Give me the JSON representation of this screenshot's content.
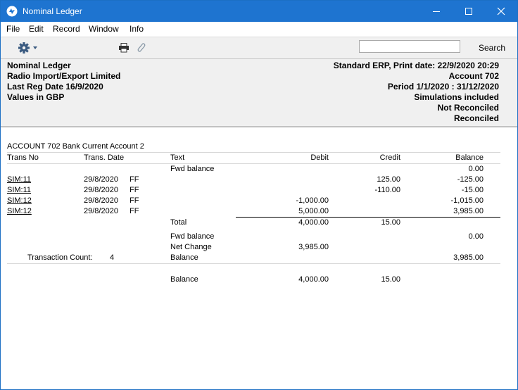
{
  "window": {
    "title": "Nominal Ledger"
  },
  "menu": [
    "File",
    "Edit",
    "Record",
    "Window",
    "Info"
  ],
  "toolbar": {
    "search_label": "Search",
    "search_value": ""
  },
  "header": {
    "left": [
      "Nominal Ledger",
      "Radio Import/Export Limited",
      "Last Reg Date  16/9/2020",
      "Values in GBP"
    ],
    "right": [
      "Standard ERP, Print date: 22/9/2020 20:29",
      "Account  702",
      "Period  1/1/2020 : 31/12/2020",
      "Simulations included",
      "Not Reconciled",
      "Reconciled"
    ]
  },
  "report": {
    "account_title": "ACCOUNT 702  Bank Current Account 2",
    "columns": {
      "trans_no": "Trans No",
      "trans_date": "Trans. Date",
      "text": "Text",
      "debit": "Debit",
      "credit": "Credit",
      "balance": "Balance"
    },
    "fwd_label": "Fwd balance",
    "fwd_balance": "0.00",
    "rows": [
      {
        "trans_no": "SIM:11",
        "date": "29/8/2020",
        "code": "FF",
        "debit": "",
        "credit": "125.00",
        "balance": "-125.00"
      },
      {
        "trans_no": "SIM:11",
        "date": "29/8/2020",
        "code": "FF",
        "debit": "",
        "credit": "-110.00",
        "balance": "-15.00"
      },
      {
        "trans_no": "SIM:12",
        "date": "29/8/2020",
        "code": "FF",
        "debit": "-1,000.00",
        "credit": "",
        "balance": "-1,015.00"
      },
      {
        "trans_no": "SIM:12",
        "date": "29/8/2020",
        "code": "FF",
        "debit": "5,000.00",
        "credit": "",
        "balance": "3,985.00"
      }
    ],
    "total": {
      "label": "Total",
      "debit": "4,000.00",
      "credit": "15.00"
    },
    "summary": {
      "fwd_label": "Fwd balance",
      "fwd_balance": "0.00",
      "net_change_label": "Net Change",
      "net_change_debit": "3,985.00",
      "balance_label": "Balance",
      "balance_value": "3,985.00",
      "count_label": "Transaction Count:",
      "count_value": "4"
    },
    "grand": {
      "label": "Balance",
      "debit": "4,000.00",
      "credit": "15.00"
    }
  }
}
